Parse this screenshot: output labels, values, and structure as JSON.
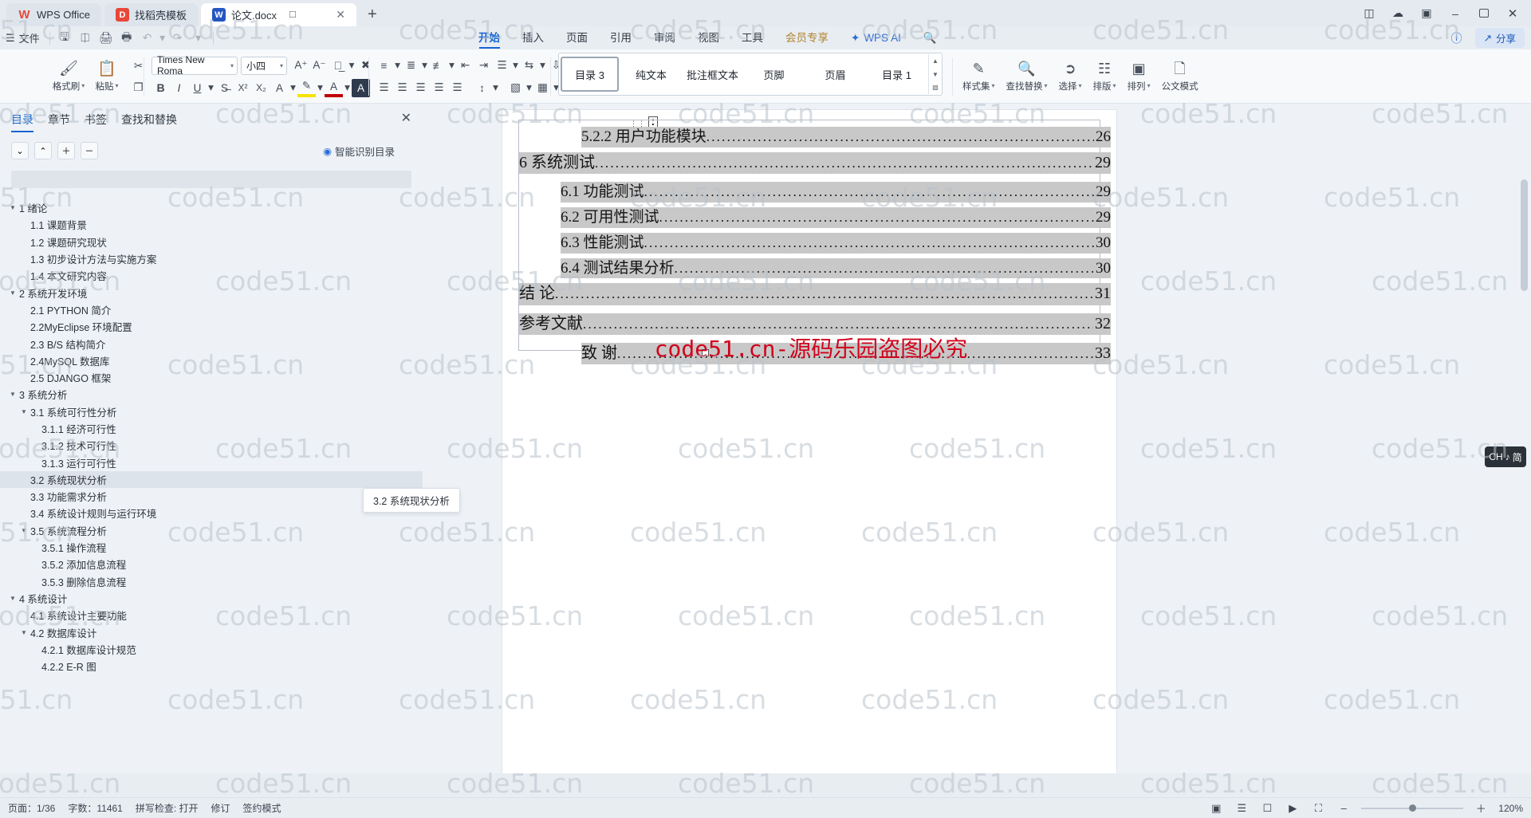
{
  "titlebar": {
    "tabs": [
      {
        "label": "WPS Office",
        "icon": "wps-logo-icon"
      },
      {
        "label": "找稻壳模板",
        "icon": "docer-icon"
      },
      {
        "label": "论文.docx",
        "icon": "word-doc-icon"
      }
    ],
    "new_tab": "+",
    "window_buttons": {
      "restore": "❐",
      "minimize": "–",
      "maximize": "▫",
      "close": "✕"
    },
    "right_icons": [
      "sidebar-toggle-icon",
      "cloud-sync-icon",
      "screen-icon"
    ]
  },
  "quickaccess": {
    "file_menu": "文件",
    "icons": [
      "save-icon",
      "save-as-cloud-icon",
      "print-icon",
      "print-preview-icon",
      "undo-icon",
      "redo-icon",
      "more-icon"
    ]
  },
  "ribbon_tabs": [
    {
      "label": "开始",
      "active": true
    },
    {
      "label": "插入",
      "active": false
    },
    {
      "label": "页面",
      "active": false
    },
    {
      "label": "引用",
      "active": false
    },
    {
      "label": "审阅",
      "active": false
    },
    {
      "label": "视图",
      "active": false
    },
    {
      "label": "工具",
      "active": false
    },
    {
      "label": "会员专享",
      "active": false
    }
  ],
  "ai_button": {
    "label": "WPS AI",
    "icon": "ai-sparkle-icon"
  },
  "search_icon": "search-icon",
  "header_right": {
    "help_icon": "help-icon",
    "share_label": "分享",
    "share_icon": "share-icon"
  },
  "ribbon": {
    "clipboard": [
      {
        "label": "格式刷",
        "icon": "format-painter-icon"
      },
      {
        "label": "粘贴",
        "icon": "paste-icon"
      },
      {
        "label": "",
        "icon": "cut-icon"
      },
      {
        "label": "",
        "icon": "copy-icon"
      }
    ],
    "font": {
      "name": "Times New Roma",
      "size": "小四",
      "grow_icon": "increase-font-icon",
      "shrink_icon": "decrease-font-icon",
      "pinyin_icon": "pinyin-guide-icon",
      "clear_icon": "clear-format-icon",
      "bold": "B",
      "italic": "I",
      "underline": "U",
      "strike_icon": "strikethrough-icon",
      "superscript": "X²",
      "subscript": "X₂",
      "text_effect_icon": "text-effect-icon",
      "highlight_icon": "highlight-color-icon",
      "fontcolor_icon": "font-color-icon",
      "charshade_icon": "character-shading-icon"
    },
    "paragraph": {
      "bullets_icon": "bullets-icon",
      "numbering_icon": "numbering-icon",
      "multilevel_icon": "multilevel-list-icon",
      "dec_indent_icon": "decrease-indent-icon",
      "inc_indent_icon": "increase-indent-icon",
      "align_left_icon": "align-left-icon",
      "align_center_icon": "align-center-icon",
      "align_right_icon": "align-right-icon",
      "justify_icon": "justify-icon",
      "distribute_icon": "distribute-icon",
      "line_spacing_icon": "line-spacing-icon",
      "shading_icon": "shading-icon",
      "borders_icon": "borders-icon",
      "pinyin2_icon": "phonetic-icon",
      "charborder_icon": "character-border-icon",
      "sort_icon": "sort-icon",
      "show_marks_icon": "show-formatting-marks-icon"
    },
    "styles": [
      {
        "label": "目录 3",
        "selected": true
      },
      {
        "label": "纯文本",
        "selected": false
      },
      {
        "label": "批注框文本",
        "selected": false
      },
      {
        "label": "页脚",
        "selected": false
      },
      {
        "label": "页眉",
        "selected": false
      },
      {
        "label": "目录 1",
        "selected": false
      }
    ],
    "tools": [
      {
        "label": "样式集",
        "icon": "style-set-icon"
      },
      {
        "label": "查找替换",
        "icon": "find-replace-icon"
      },
      {
        "label": "选择",
        "icon": "select-icon"
      },
      {
        "label": "排版",
        "icon": "typesetting-icon"
      },
      {
        "label": "排列",
        "icon": "arrange-icon"
      },
      {
        "label": "公文模式",
        "icon": "official-doc-mode-icon"
      }
    ]
  },
  "navpane": {
    "tabs": [
      {
        "label": "目录",
        "active": true
      },
      {
        "label": "章节",
        "active": false
      },
      {
        "label": "书签",
        "active": false
      },
      {
        "label": "查找和替换",
        "active": false
      }
    ],
    "close_icon": "close-icon",
    "buttons": [
      {
        "icon": "collapse-down-icon",
        "glyph": "⌄"
      },
      {
        "icon": "collapse-up-icon",
        "glyph": "⌃"
      },
      {
        "icon": "expand-level-icon",
        "glyph": "＋"
      },
      {
        "icon": "collapse-level-icon",
        "glyph": "－"
      }
    ],
    "smart_toc": {
      "label": "智能识别目录",
      "icon": "smart-toc-icon"
    },
    "items": [
      {
        "text": "1  绪论",
        "indent": 0,
        "arrow": "▼",
        "selected": false
      },
      {
        "text": "1.1  课题背景",
        "indent": 1,
        "arrow": "",
        "selected": false
      },
      {
        "text": "1.2  课题研究现状",
        "indent": 1,
        "arrow": "",
        "selected": false
      },
      {
        "text": "1.3  初步设计方法与实施方案",
        "indent": 1,
        "arrow": "",
        "selected": false
      },
      {
        "text": "1.4  本文研究内容",
        "indent": 1,
        "arrow": "",
        "selected": false
      },
      {
        "text": "2  系统开发环境",
        "indent": 0,
        "arrow": "▼",
        "selected": false
      },
      {
        "text": "2.1 PYTHON 简介",
        "indent": 1,
        "arrow": "",
        "selected": false
      },
      {
        "text": "2.2MyEclipse 环境配置",
        "indent": 1,
        "arrow": "",
        "selected": false
      },
      {
        "text": "2.3 B/S 结构简介",
        "indent": 1,
        "arrow": "",
        "selected": false
      },
      {
        "text": "2.4MySQL 数据库",
        "indent": 1,
        "arrow": "",
        "selected": false
      },
      {
        "text": "2.5 DJANGO 框架",
        "indent": 1,
        "arrow": "",
        "selected": false
      },
      {
        "text": "3  系统分析",
        "indent": 0,
        "arrow": "▼",
        "selected": false
      },
      {
        "text": "3.1  系统可行性分析",
        "indent": 1,
        "arrow": "▼",
        "selected": false
      },
      {
        "text": "3.1.1  经济可行性",
        "indent": 2,
        "arrow": "",
        "selected": false
      },
      {
        "text": "3.1.2  技术可行性",
        "indent": 2,
        "arrow": "",
        "selected": false
      },
      {
        "text": "3.1.3  运行可行性",
        "indent": 2,
        "arrow": "",
        "selected": false
      },
      {
        "text": "3.2  系统现状分析",
        "indent": 1,
        "arrow": "",
        "selected": true
      },
      {
        "text": "3.3  功能需求分析",
        "indent": 1,
        "arrow": "",
        "selected": false
      },
      {
        "text": "3.4  系统设计规则与运行环境",
        "indent": 1,
        "arrow": "",
        "selected": false
      },
      {
        "text": "3.5 系统流程分析",
        "indent": 1,
        "arrow": "▼",
        "selected": false
      },
      {
        "text": "3.5.1 操作流程",
        "indent": 2,
        "arrow": "",
        "selected": false
      },
      {
        "text": "3.5.2 添加信息流程",
        "indent": 2,
        "arrow": "",
        "selected": false
      },
      {
        "text": "3.5.3 删除信息流程",
        "indent": 2,
        "arrow": "",
        "selected": false
      },
      {
        "text": "4  系统设计",
        "indent": 0,
        "arrow": "▼",
        "selected": false
      },
      {
        "text": "4.1  系统设计主要功能",
        "indent": 1,
        "arrow": "",
        "selected": false
      },
      {
        "text": "4.2  数据库设计",
        "indent": 1,
        "arrow": "▼",
        "selected": false
      },
      {
        "text": "4.2.1  数据库设计规范",
        "indent": 2,
        "arrow": "",
        "selected": false
      },
      {
        "text": "4.2.2 E-R 图",
        "indent": 2,
        "arrow": "",
        "selected": false
      }
    ],
    "tooltip": "3.2 系统现状分析"
  },
  "document": {
    "toc_lines": [
      {
        "label": "5.2.2    用户功能模块",
        "page": "26",
        "indent": 3,
        "size": "sub"
      },
      {
        "label": "6  系统测试",
        "page": "29",
        "indent": 0,
        "size": "main"
      },
      {
        "label": "6.1  功能测试",
        "page": "29",
        "indent": 2,
        "size": "sub"
      },
      {
        "label": "6.2  可用性测试",
        "page": "29",
        "indent": 2,
        "size": "sub"
      },
      {
        "label": "6.3  性能测试",
        "page": "30",
        "indent": 2,
        "size": "sub"
      },
      {
        "label": "6.4  测试结果分析",
        "page": "30",
        "indent": 2,
        "size": "sub"
      },
      {
        "label": "结  论",
        "page": "31",
        "indent": 0,
        "size": "main"
      },
      {
        "label": "参考文献",
        "page": "32",
        "indent": 0,
        "size": "main"
      },
      {
        "label": "致  谢",
        "page": "33",
        "indent": 3,
        "size": "main"
      }
    ],
    "red_watermark": "code51.cn-源码乐园盗图必究",
    "language_pill": {
      "label": "CH",
      "mode": "简",
      "icon": "ime-icon"
    }
  },
  "watermark": {
    "text": "code51.cn",
    "color": "#b9c2cb"
  },
  "statusbar": {
    "page_info": "页面：1/36",
    "word_count": "字数：11461",
    "spellcheck": "拼写检查: 打开",
    "revision": "修订",
    "document_mode": "签约模式",
    "view_icons": [
      "page-view-icon",
      "outline-view-icon",
      "web-view-icon",
      "reading-view-icon",
      "fullscreen-icon"
    ],
    "zoom_out": "–",
    "zoom_in": "＋",
    "zoom_level": "120%"
  }
}
